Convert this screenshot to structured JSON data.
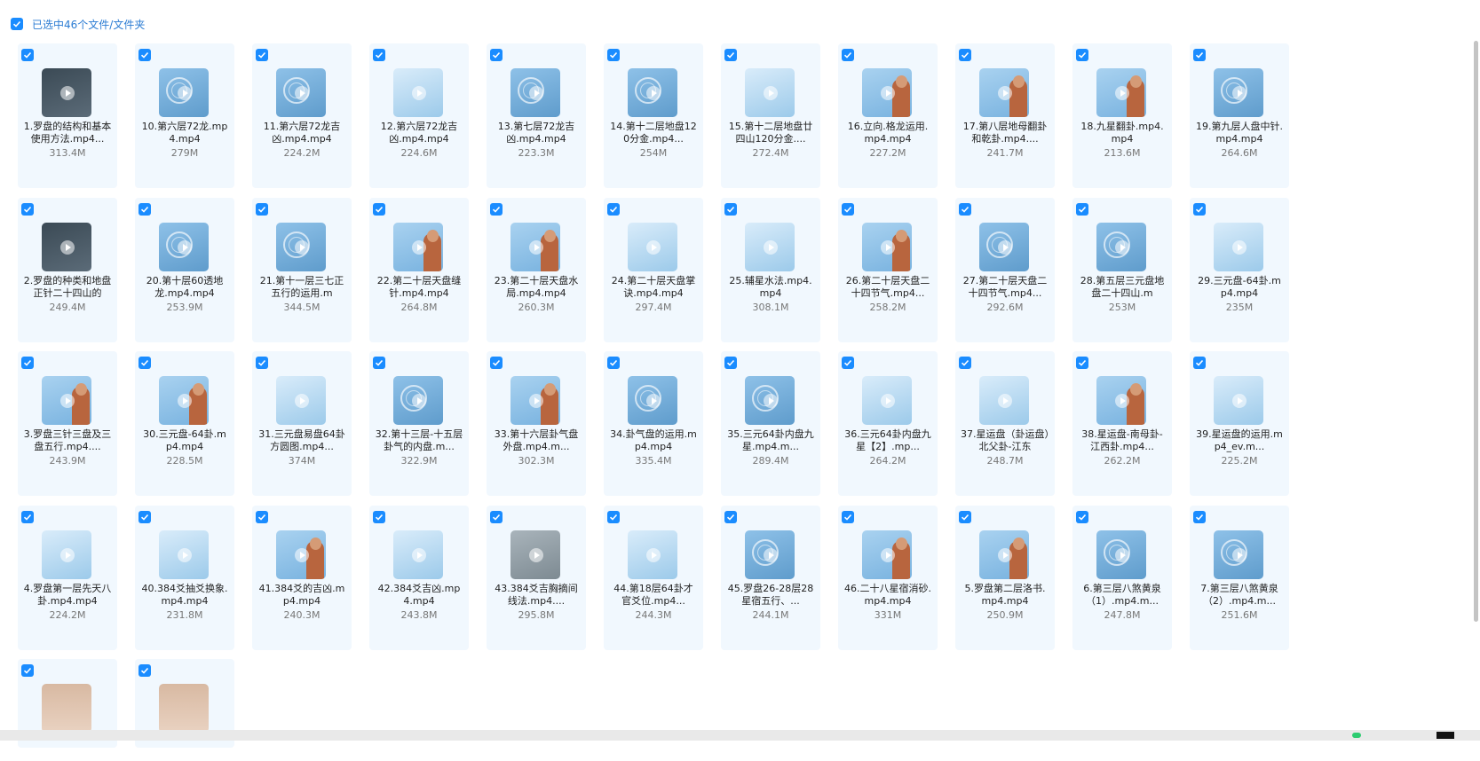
{
  "header": {
    "selected_label": "已选中46个文件/文件夹"
  },
  "colors": {
    "accent": "#1a8cff",
    "card_bg": "#f1f8fe"
  },
  "files": [
    {
      "name": "1.罗盘的结构和基本使用方法.mp4...",
      "size": "313.4M",
      "checked": true,
      "thumb": "dark"
    },
    {
      "name": "10.第六层72龙.mp4.mp4",
      "size": "279M",
      "checked": true,
      "thumb": "wheel"
    },
    {
      "name": "11.第六层72龙吉凶.mp4.mp4",
      "size": "224.2M",
      "checked": true,
      "thumb": "wheel"
    },
    {
      "name": "12.第六层72龙吉凶.mp4.mp4",
      "size": "224.6M",
      "checked": true,
      "thumb": "board"
    },
    {
      "name": "13.第七层72龙吉凶.mp4.mp4",
      "size": "223.3M",
      "checked": true,
      "thumb": "wheel"
    },
    {
      "name": "14.第十二层地盘120分金.mp4...",
      "size": "254M",
      "checked": true,
      "thumb": "wheel"
    },
    {
      "name": "15.第十二层地盘廿四山120分金....",
      "size": "272.4M",
      "checked": true,
      "thumb": "board"
    },
    {
      "name": "16.立向.格龙运用.mp4.mp4",
      "size": "227.2M",
      "checked": true,
      "thumb": "person"
    },
    {
      "name": "17.第八层地母翻卦和乾卦.mp4....",
      "size": "241.7M",
      "checked": true,
      "thumb": "person"
    },
    {
      "name": "18.九星翻卦.mp4.mp4",
      "size": "213.6M",
      "checked": true,
      "thumb": "person"
    },
    {
      "name": "19.第九层人盘中针.mp4.mp4",
      "size": "264.6M",
      "checked": true,
      "thumb": "wheel"
    },
    {
      "name": "2.罗盘的种类和地盘正针二十四山的",
      "size": "249.4M",
      "checked": true,
      "thumb": "dark"
    },
    {
      "name": "20.第十层60透地龙.mp4.mp4",
      "size": "253.9M",
      "checked": true,
      "thumb": "wheel"
    },
    {
      "name": "21.第十一层三七正五行的运用.m",
      "size": "344.5M",
      "checked": true,
      "thumb": "wheel"
    },
    {
      "name": "22.第二十层天盘缝针.mp4.mp4",
      "size": "264.8M",
      "checked": true,
      "thumb": "person"
    },
    {
      "name": "23.第二十层天盘水局.mp4.mp4",
      "size": "260.3M",
      "checked": true,
      "thumb": "person"
    },
    {
      "name": "24.第二十层天盘掌诀.mp4.mp4",
      "size": "297.4M",
      "checked": true,
      "thumb": "board"
    },
    {
      "name": "25.辅星水法.mp4.mp4",
      "size": "308.1M",
      "checked": true,
      "thumb": "board"
    },
    {
      "name": "26.第二十层天盘二十四节气.mp4...",
      "size": "258.2M",
      "checked": true,
      "thumb": "person"
    },
    {
      "name": "27.第二十层天盘二十四节气.mp4...",
      "size": "292.6M",
      "checked": true,
      "thumb": "wheel"
    },
    {
      "name": "28.第五层三元盘地盘二十四山.m",
      "size": "253M",
      "checked": true,
      "thumb": "wheel"
    },
    {
      "name": "29.三元盘-64卦.mp4.mp4",
      "size": "235M",
      "checked": true,
      "thumb": "board"
    },
    {
      "name": "3.罗盘三针三盘及三盘五行.mp4....",
      "size": "243.9M",
      "checked": true,
      "thumb": "person"
    },
    {
      "name": "30.三元盘-64卦.mp4.mp4",
      "size": "228.5M",
      "checked": true,
      "thumb": "person"
    },
    {
      "name": "31.三元盘易盘64卦方圆图.mp4...",
      "size": "374M",
      "checked": true,
      "thumb": "board"
    },
    {
      "name": "32.第十三层-十五层卦气的内盘.m...",
      "size": "322.9M",
      "checked": true,
      "thumb": "wheel"
    },
    {
      "name": "33.第十六层卦气盘外盘.mp4.m...",
      "size": "302.3M",
      "checked": true,
      "thumb": "person"
    },
    {
      "name": "34.卦气盘的运用.mp4.mp4",
      "size": "335.4M",
      "checked": true,
      "thumb": "wheel"
    },
    {
      "name": "35.三元64卦内盘九星.mp4.m...",
      "size": "289.4M",
      "checked": true,
      "thumb": "wheel"
    },
    {
      "name": "36.三元64卦内盘九星【2】.mp...",
      "size": "264.2M",
      "checked": true,
      "thumb": "board"
    },
    {
      "name": "37.星运盘（卦运盘）北父卦-江东",
      "size": "248.7M",
      "checked": true,
      "thumb": "board"
    },
    {
      "name": "38.星运盘-南母卦-江西卦.mp4...",
      "size": "262.2M",
      "checked": true,
      "thumb": "person"
    },
    {
      "name": "39.星运盘的运用.mp4_ev.m...",
      "size": "225.2M",
      "checked": true,
      "thumb": "board"
    },
    {
      "name": "4.罗盘第一层先天八卦.mp4.mp4",
      "size": "224.2M",
      "checked": true,
      "thumb": "board"
    },
    {
      "name": "40.384爻抽爻换象.mp4.mp4",
      "size": "231.8M",
      "checked": true,
      "thumb": "board"
    },
    {
      "name": "41.384爻的吉凶.mp4.mp4",
      "size": "240.3M",
      "checked": true,
      "thumb": "person"
    },
    {
      "name": "42.384爻吉凶.mp4.mp4",
      "size": "243.8M",
      "checked": true,
      "thumb": "board"
    },
    {
      "name": "43.384爻吉胸摘间线法.mp4....",
      "size": "295.8M",
      "checked": true,
      "thumb": "grey"
    },
    {
      "name": "44.第18层64卦才官爻位.mp4...",
      "size": "244.3M",
      "checked": true,
      "thumb": "board"
    },
    {
      "name": "45.罗盘26-28层28星宿五行、...",
      "size": "244.1M",
      "checked": true,
      "thumb": "wheel"
    },
    {
      "name": "46.二十八星宿消砂.mp4.mp4",
      "size": "331M",
      "checked": true,
      "thumb": "person"
    },
    {
      "name": "5.罗盘第二层洛书.mp4.mp4",
      "size": "250.9M",
      "checked": true,
      "thumb": "person"
    },
    {
      "name": "6.第三层八煞黄泉（1）.mp4.m...",
      "size": "247.8M",
      "checked": true,
      "thumb": "wheel"
    },
    {
      "name": "7.第三层八煞黄泉（2）.mp4.m...",
      "size": "251.6M",
      "checked": true,
      "thumb": "wheel"
    },
    {
      "name": "",
      "size": "",
      "checked": true,
      "thumb": "partial"
    },
    {
      "name": "",
      "size": "",
      "checked": true,
      "thumb": "partial"
    }
  ]
}
